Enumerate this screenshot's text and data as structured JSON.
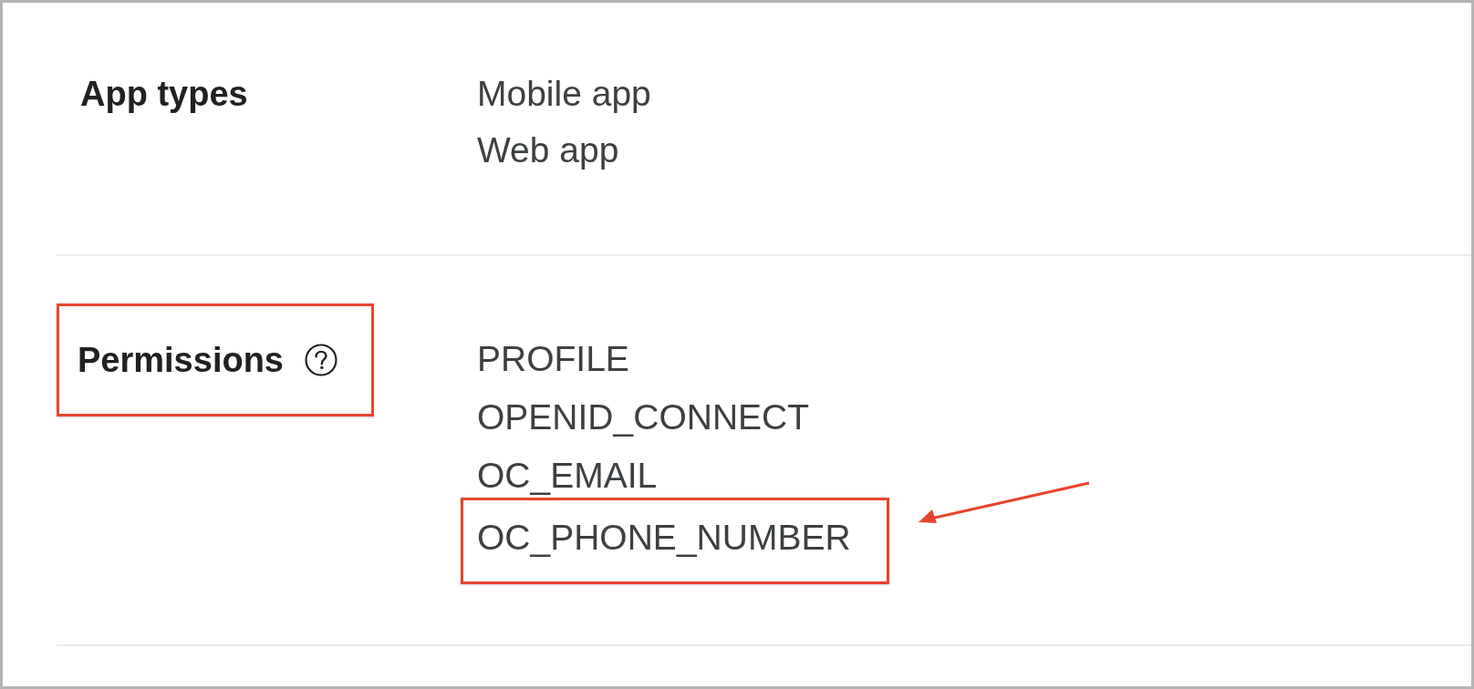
{
  "sections": [
    {
      "label": {
        "text": "App types",
        "highlighted": false,
        "help": false
      },
      "values": [
        {
          "text": "Mobile app",
          "highlighted": false,
          "arrow": false
        },
        {
          "text": "Web app",
          "highlighted": false,
          "arrow": false
        }
      ]
    },
    {
      "label": {
        "text": "Permissions",
        "highlighted": true,
        "help": true
      },
      "values": [
        {
          "text": "PROFILE",
          "highlighted": false,
          "arrow": false
        },
        {
          "text": "OPENID_CONNECT",
          "highlighted": false,
          "arrow": false
        },
        {
          "text": "OC_EMAIL",
          "highlighted": false,
          "arrow": false
        },
        {
          "text": "OC_PHONE_NUMBER",
          "highlighted": true,
          "arrow": true
        }
      ]
    }
  ]
}
